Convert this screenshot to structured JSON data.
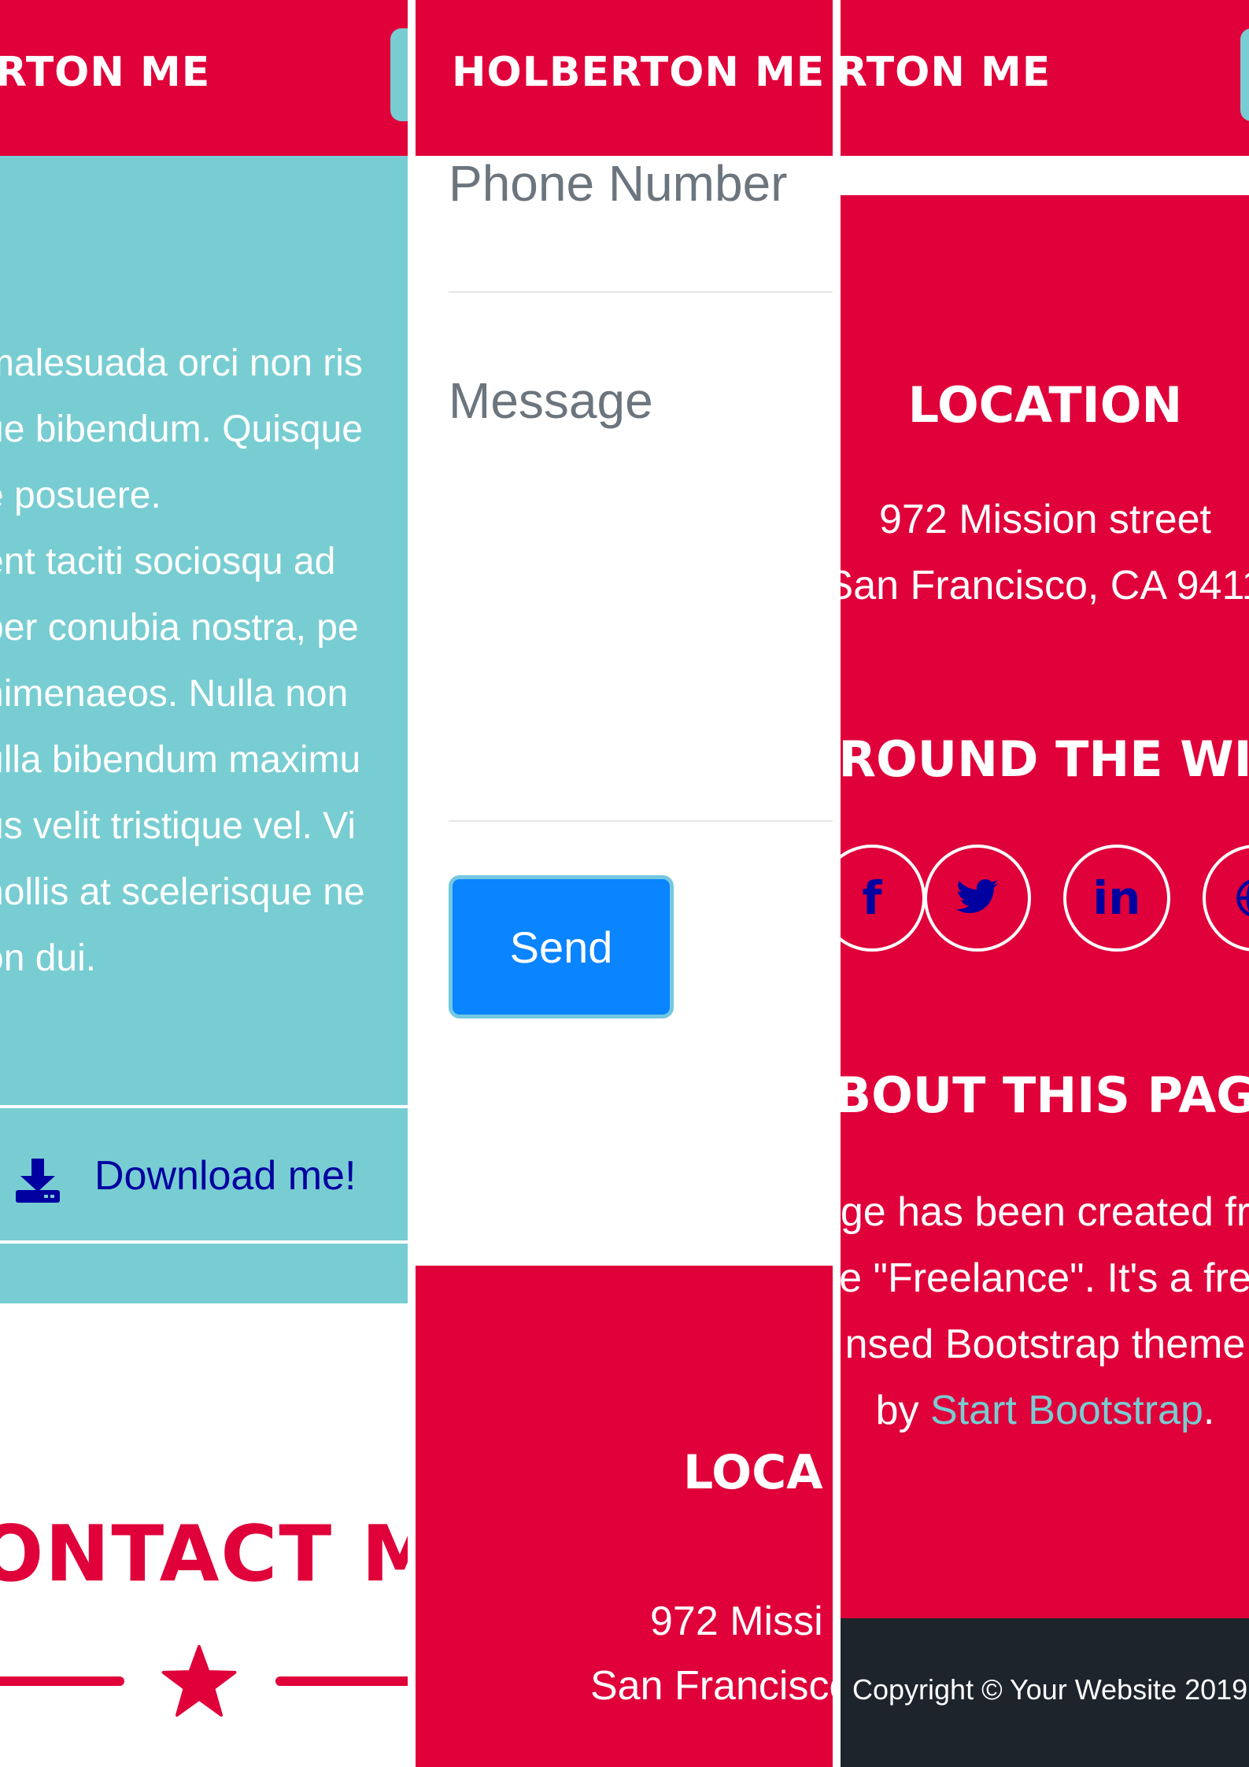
{
  "navbar": {
    "brand": "HOLBERTON ME",
    "brand_cut_left": "RTON ME"
  },
  "about": {
    "paragraph_lines": [
      "malesuada orci non ris",
      "ue bibendum. Quisque",
      "e posuere.",
      "ent taciti sociosqu ad",
      "per conubia nostra, pe",
      "nimenaeos. Nulla non",
      "ulla bibendum maximu",
      "us velit tristique vel. Vi",
      "nollis at scelerisque ne",
      "on dui."
    ],
    "download_label": "Download me!"
  },
  "contact": {
    "heading_fragment": "ONTACT M",
    "phone_placeholder": "Phone Number",
    "message_placeholder": "Message",
    "send_label": "Send"
  },
  "footer": {
    "location_heading": "LOCATION",
    "location_heading_fragment": "LOCA",
    "address_line1": "972 Mission street",
    "address_line2": "San Francisco, CA 9411",
    "address_line1_fragment": "972 Missi",
    "address_line2_fragment": "San Francisco",
    "around_heading_fragment": "ROUND THE WI",
    "about_heading_fragment": "BOUT THIS PAG",
    "about_lines": [
      "ge has been created fr",
      "e \"Freelance\". It's a fre",
      "nsed Bootstrap theme"
    ],
    "about_by": "by ",
    "about_link": "Start Bootstrap",
    "about_end": ".",
    "social_icons": [
      "facebook-icon",
      "twitter-icon",
      "linkedin-icon",
      "globe-icon"
    ],
    "copyright": "Copyright © Your Website 2019"
  },
  "colors": {
    "brand_red": "#e0003a",
    "teal": "#78cdd2",
    "navy": "#0000a0",
    "button_blue": "#0a84ff",
    "dark_footer": "#1d242c"
  }
}
